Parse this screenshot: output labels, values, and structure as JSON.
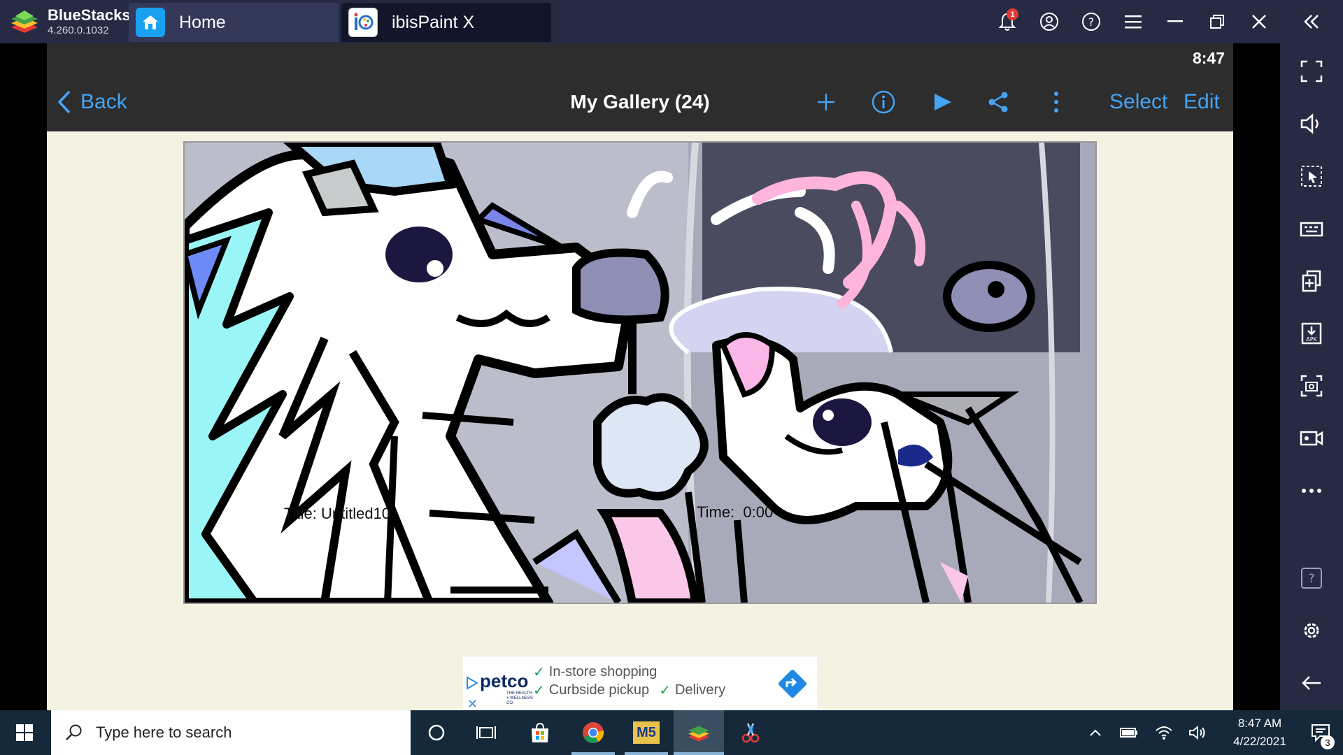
{
  "titlebar": {
    "brand_name": "BlueStacks",
    "brand_version": "4.260.0.1032",
    "tabs": [
      {
        "label": "Home",
        "icon": "home-icon"
      },
      {
        "label": "ibisPaint X",
        "icon": "ibispaint-app-icon"
      }
    ],
    "notification_count": "1",
    "icons": [
      "bell-icon",
      "account-icon",
      "help-icon",
      "menu-icon",
      "minimize-icon",
      "restore-icon",
      "close-icon",
      "collapse-sidebar-icon"
    ]
  },
  "sidebar": {
    "icons": [
      "fullscreen-icon",
      "volume-icon",
      "pointer-select-icon",
      "keyboard-icon",
      "multi-instance-icon",
      "install-apk-icon",
      "screenshot-icon",
      "record-icon",
      "more-icon",
      "help-icon",
      "settings-icon",
      "back-icon"
    ]
  },
  "android": {
    "clock": "8:47",
    "appbar": {
      "back_label": "Back",
      "title": "My Gallery (24)",
      "select_label": "Select",
      "edit_label": "Edit"
    },
    "artwork": {
      "title_caption": "Title: Untitled10",
      "time_caption": "Time:  0:00"
    },
    "ad": {
      "brand": "petco",
      "brand_sub": "THE HEALTH + WELLNESS CO.",
      "line1": "In-store shopping",
      "line2a": "Curbside pickup",
      "line2b": "Delivery"
    }
  },
  "taskbar": {
    "search_placeholder": "Type here to search",
    "time": "8:47 AM",
    "date": "4/22/2021",
    "notification_count": "3",
    "m5_label": "M5"
  },
  "colors": {
    "title_bar": "#262a43",
    "app_bar": "#2d2d2d",
    "accent_blue": "#45a4f5",
    "canvas_bg": "#f4f2e2",
    "taskbar": "#15293a"
  }
}
